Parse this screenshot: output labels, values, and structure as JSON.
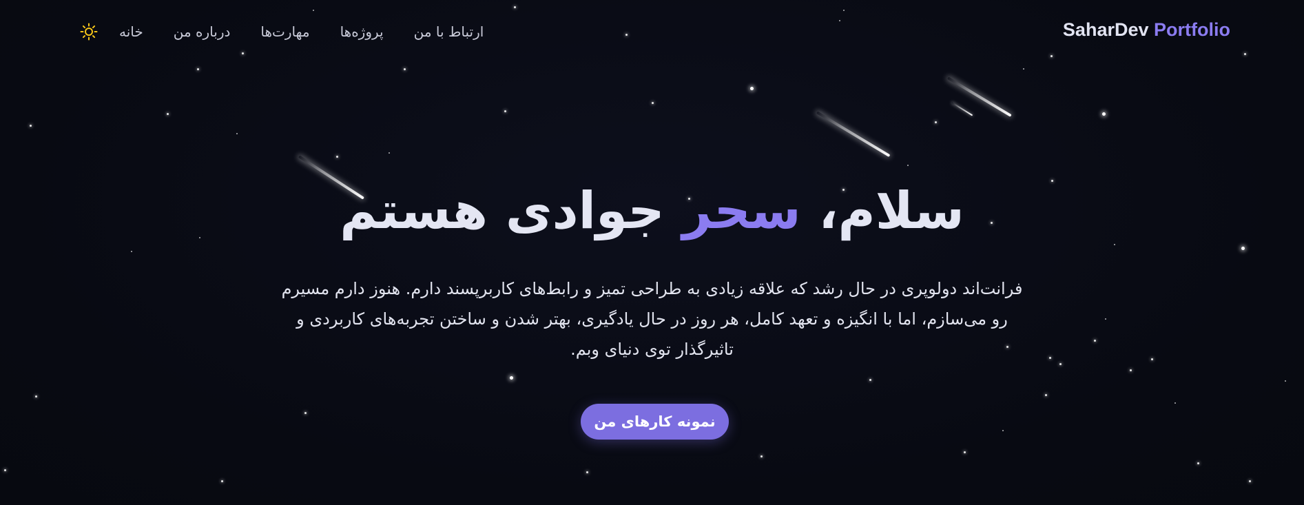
{
  "header": {
    "brand_primary": "SaharDev",
    "brand_secondary": "Portfolio",
    "nav": {
      "home": "خانه",
      "about": "درباره من",
      "skills": "مهارت‌ها",
      "projects": "پروژه‌ها",
      "contact": "ارتباط با من"
    },
    "theme_toggle_icon": "sun-icon"
  },
  "hero": {
    "title_start": "سلام، ",
    "title_accent": "سحر",
    "title_end": " جوادی هستم",
    "description": "فرانت‌اند دولوپری در حال رشد که علاقه زیادی به طراحی تمیز و رابط‌های کاربرپسند دارم. هنوز دارم مسیرم رو می‌سازم، اما با انگیزه و تعهد کامل، هر روز در حال یادگیری، بهتر شدن و ساختن تجربه‌های کاربردی و تاثیرگذار توی دنیای وبم.",
    "cta_label": "نمونه کارهای من"
  },
  "colors": {
    "background": "#090b14",
    "accent": "#8b7cf0",
    "button": "#7c6ee0",
    "text": "#e4e6f3",
    "sun_icon": "#f5c518"
  }
}
